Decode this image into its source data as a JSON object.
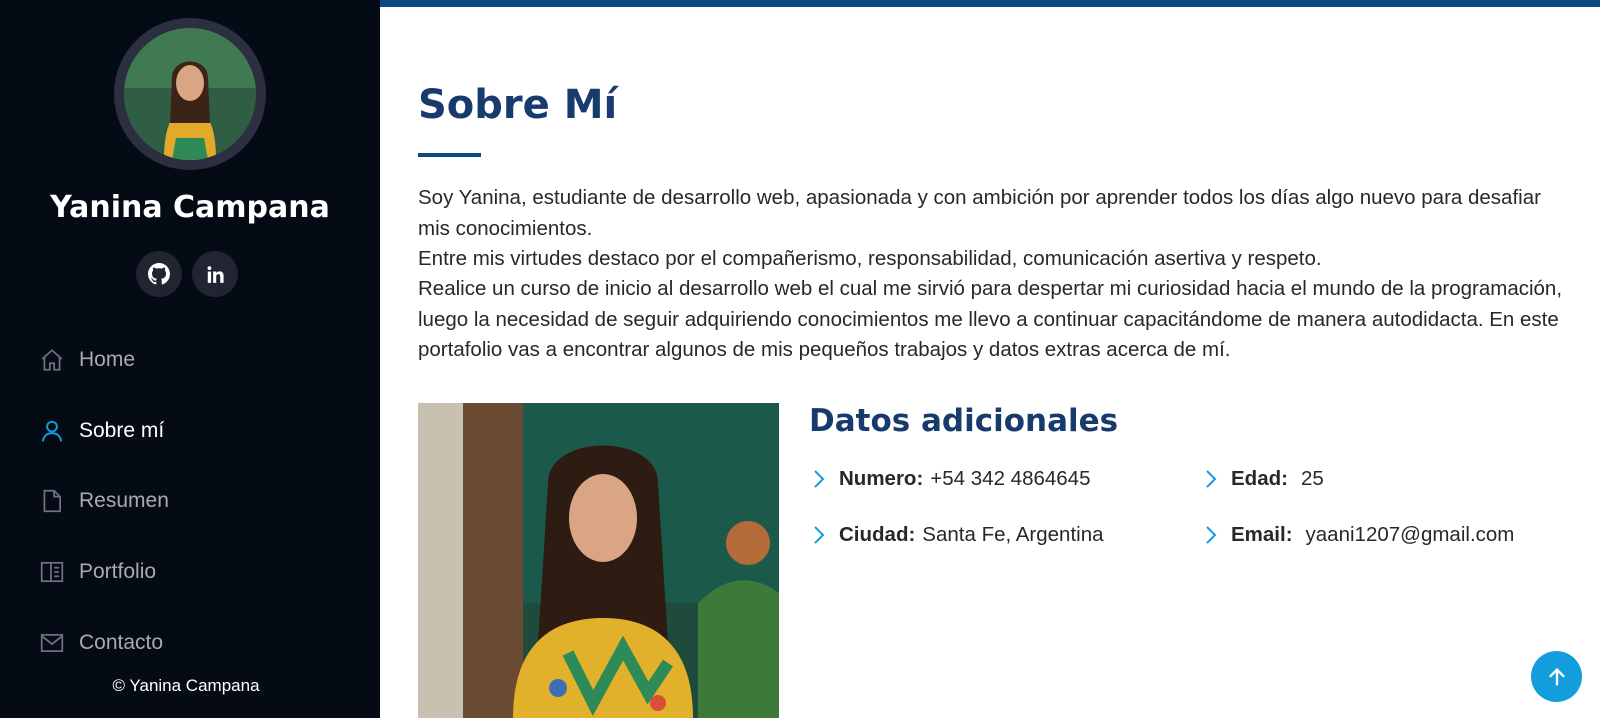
{
  "profile": {
    "name": "Yanina Campana",
    "avatar_alt": "profile-photo"
  },
  "social": [
    {
      "icon": "github-icon"
    },
    {
      "icon": "linkedin-icon"
    }
  ],
  "nav": {
    "items": [
      {
        "label": "Home",
        "icon": "home-icon",
        "active": false
      },
      {
        "label": "Sobre mí",
        "icon": "person-icon",
        "active": true
      },
      {
        "label": "Resumen",
        "icon": "file-icon",
        "active": false
      },
      {
        "label": "Portfolio",
        "icon": "portfolio-icon",
        "active": false
      },
      {
        "label": "Contacto",
        "icon": "envelope-icon",
        "active": false
      }
    ]
  },
  "footer": {
    "copyright": "© Yanina Campana"
  },
  "about": {
    "title": "Sobre Mí",
    "paragraphs": [
      "Soy Yanina, estudiante de desarrollo web, apasionada y con ambición por aprender todos los días algo nuevo para desafiar mis conocimientos.",
      "Entre mis virtudes destaco por el compañerismo, responsabilidad, comunicación asertiva y respeto.",
      "Realice un curso de inicio al desarrollo web el cual me sirvió para despertar mi curiosidad hacia el mundo de la programación, luego la necesidad de seguir adquiriendo conocimientos me llevo a continuar capacitándome de manera autodidacta. En este portafolio vas a encontrar algunos de mis pequeños trabajos y datos extras acerca de mí."
    ]
  },
  "details": {
    "title": "Datos adicionales",
    "numero": {
      "label": "Numero:",
      "value": "+54 342 4864645"
    },
    "edad": {
      "label": "Edad:",
      "value": "25"
    },
    "ciudad": {
      "label": "Ciudad:",
      "value": "Santa Fe, Argentina"
    },
    "email": {
      "label": "Email:",
      "value": "yaani1207@gmail.com"
    }
  },
  "colors": {
    "sidebar_bg": "#040b14",
    "accent": "#149ddd",
    "heading": "#173b6c",
    "topbar": "#0b4a82"
  }
}
